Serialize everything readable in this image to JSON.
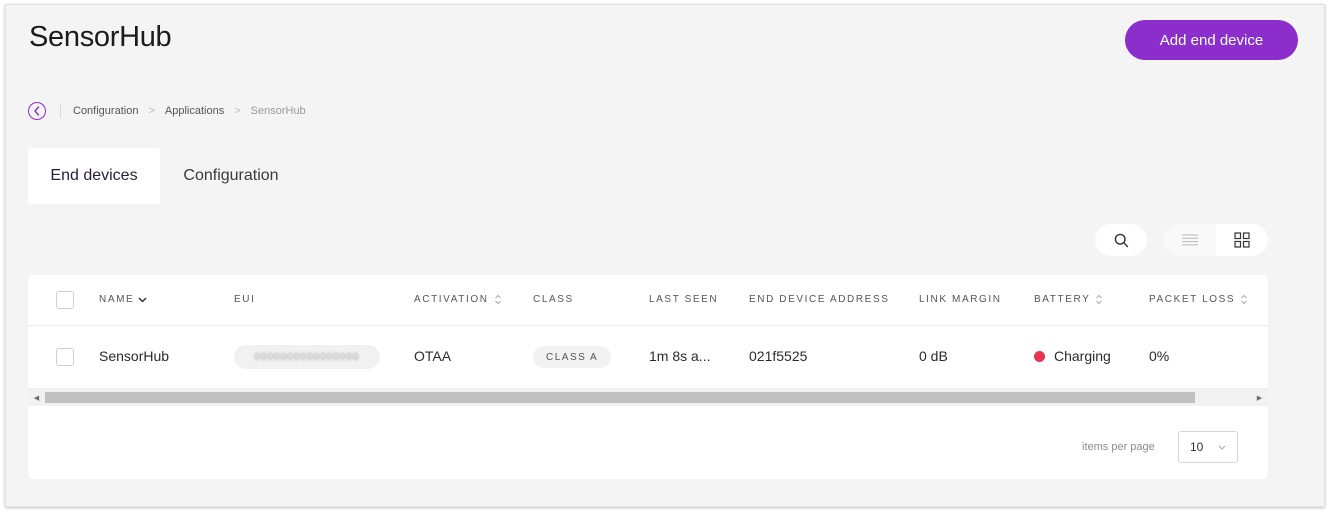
{
  "header": {
    "title": "SensorHub",
    "add_button_label": "Add end device"
  },
  "breadcrumb": {
    "items": [
      "Configuration",
      "Applications"
    ],
    "current": "SensorHub"
  },
  "tabs": [
    {
      "label": "End devices",
      "active": true
    },
    {
      "label": "Configuration",
      "active": false
    }
  ],
  "table": {
    "columns": [
      "NAME",
      "EUI",
      "ACTIVATION",
      "CLASS",
      "LAST SEEN",
      "END DEVICE ADDRESS",
      "LINK MARGIN",
      "BATTERY",
      "PACKET LOSS"
    ],
    "rows": [
      {
        "name": "SensorHub",
        "eui": "0000000000000000",
        "activation": "OTAA",
        "class": "CLASS A",
        "last_seen": "1m 8s a...",
        "address": "021f5525",
        "link_margin": "0 dB",
        "battery": "Charging",
        "packet_loss": "0%"
      }
    ]
  },
  "pagination": {
    "label": "items per page",
    "value": "10"
  },
  "colors": {
    "accent": "#8b2ecb",
    "battery_status": "#e8344f",
    "background": "#f4f4f4"
  }
}
